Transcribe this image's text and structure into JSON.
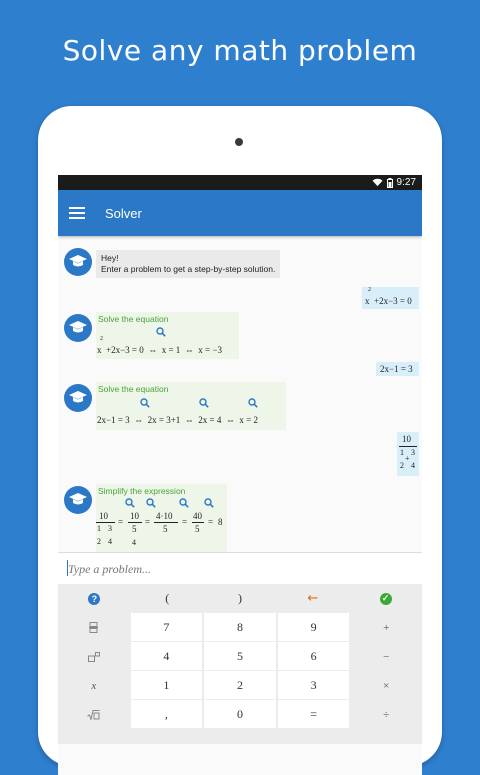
{
  "headline": "Solve any math problem",
  "status": {
    "time": "9:27"
  },
  "appbar": {
    "title": "Solver"
  },
  "chat": {
    "greeting_line1": "Hey!",
    "greeting_line2": "Enter a problem to get a step-by-step solution.",
    "msg1": {
      "exp": "2",
      "expr": "x  +2x−3 = 0"
    },
    "reply1": {
      "title": "Solve the equation",
      "exp": "2",
      "expr": "x  +2x−3 = 0  ⇔  x = 1  ⇔  x = −3"
    },
    "msg2": {
      "expr": "2x−1 = 3"
    },
    "reply2": {
      "title": "Solve the equation",
      "expr": "2x−1 = 3  ⇔  2x = 3+1  ⇔  2x = 4  ⇔  x = 2"
    },
    "msg3": {
      "num": "10",
      "den_num1": "1",
      "den_op": "+",
      "den_num2": "3",
      "den_den1": "2",
      "den_den2": "4"
    },
    "reply3": {
      "title": "Simplify the expression",
      "f1_num": "10",
      "f1_den_a": "1",
      "f1_den_b": "3",
      "f1_den_c": "2",
      "f1_den_d": "4",
      "eq1": "=",
      "f2_num": "10",
      "f2_den": "5",
      "f2_sub": "4",
      "eq2": "=",
      "f3_num": "4·10",
      "f3_den": "5",
      "eq3": "=",
      "f4_num": "40",
      "f4_den": "5",
      "eq4": "=",
      "result": "8"
    }
  },
  "input": {
    "placeholder": "Type a problem..."
  },
  "keyboard": {
    "top": [
      "?",
      "(",
      ")",
      "←",
      "✓"
    ],
    "row1": [
      "",
      "7",
      "8",
      "9",
      "+"
    ],
    "row2": [
      "",
      "4",
      "5",
      "6",
      "−"
    ],
    "row3": [
      "x",
      "1",
      "2",
      "3",
      "×"
    ],
    "row4": [
      "",
      ",",
      "0",
      "=",
      "÷"
    ]
  },
  "colors": {
    "brand": "#2b78c6",
    "background": "#2f7fcf",
    "success": "#3aaa35",
    "backspace": "#e06a1a",
    "help": "#2b78c6",
    "title_green": "#4aa13b"
  }
}
